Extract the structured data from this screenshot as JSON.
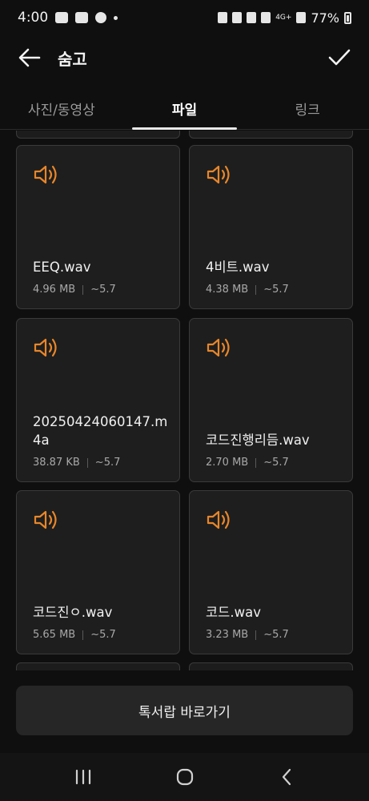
{
  "status": {
    "time": "4:00",
    "battery": "77%",
    "network": "4G+"
  },
  "header": {
    "title": "숨고"
  },
  "tabs": [
    {
      "label": "사진/동영상"
    },
    {
      "label": "파일"
    },
    {
      "label": "링크"
    }
  ],
  "files": [
    {
      "name": "EEQ.wav",
      "size": "4.96 MB",
      "date": "~5.7"
    },
    {
      "name": "4비트.wav",
      "size": "4.38 MB",
      "date": "~5.7"
    },
    {
      "name": "20250424060147.m4a",
      "size": "38.87 KB",
      "date": "~5.7"
    },
    {
      "name": "코드진행리듬.wav",
      "size": "2.70 MB",
      "date": "~5.7"
    },
    {
      "name": "코드진ㅇ.wav",
      "size": "5.65 MB",
      "date": "~5.7"
    },
    {
      "name": "코드.wav",
      "size": "3.23 MB",
      "date": "~5.7"
    }
  ],
  "footer": {
    "shortcut_label": "톡서랍 바로가기"
  },
  "colors": {
    "accent": "#e8862a",
    "background": "#0f0f0f",
    "card": "#1e1e1e"
  },
  "icons": {
    "file": "speaker-icon",
    "back": "back-arrow-icon",
    "confirm": "check-icon"
  }
}
